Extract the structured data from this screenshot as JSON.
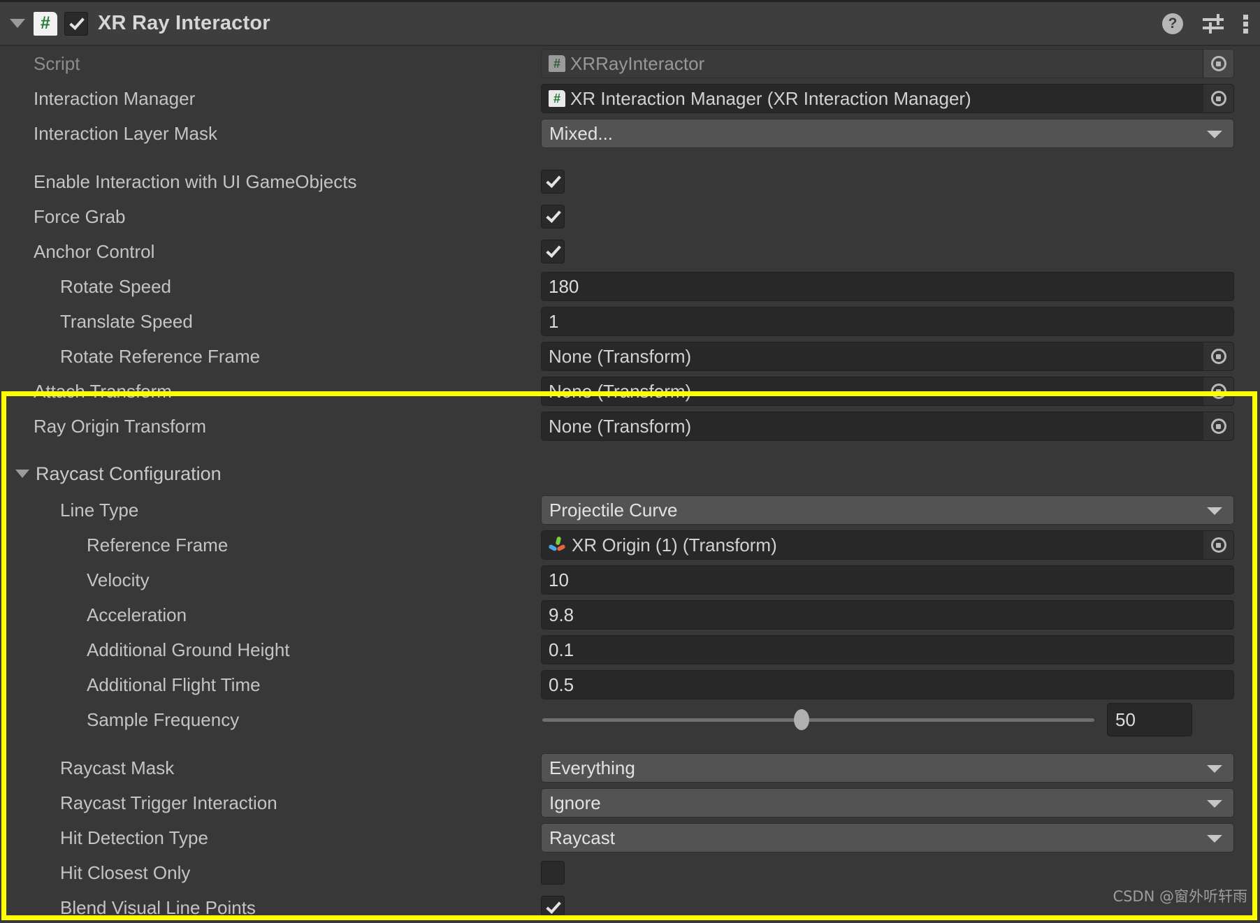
{
  "header": {
    "title": "XR Ray Interactor",
    "foldout_icon": "triangle-down-icon",
    "script_icon": "script-hash-icon",
    "enabled": true,
    "icons": {
      "help": "help-icon",
      "help_glyph": "?",
      "preset": "preset-sliders-icon",
      "menu": "kebab-menu-icon"
    }
  },
  "rows": [
    {
      "label": "Script",
      "indent": 0,
      "control": "object",
      "value": "XRRayInteractor",
      "icon": "script-hash-icon",
      "disabled": true
    },
    {
      "label": "Interaction Manager",
      "indent": 0,
      "control": "object",
      "value": "XR Interaction Manager (XR Interaction Manager)",
      "icon": "script-hash-icon"
    },
    {
      "label": "Interaction Layer Mask",
      "indent": 0,
      "control": "dropdown",
      "value": "Mixed..."
    },
    {
      "label": "Enable Interaction with UI GameObjects",
      "indent": 0,
      "control": "checkbox",
      "value": true,
      "gap": true
    },
    {
      "label": "Force Grab",
      "indent": 0,
      "control": "checkbox",
      "value": true
    },
    {
      "label": "Anchor Control",
      "indent": 0,
      "control": "checkbox",
      "value": true
    },
    {
      "label": "Rotate Speed",
      "indent": 1,
      "control": "text",
      "value": "180"
    },
    {
      "label": "Translate Speed",
      "indent": 1,
      "control": "text",
      "value": "1"
    },
    {
      "label": "Rotate Reference Frame",
      "indent": 1,
      "control": "object",
      "value": "None (Transform)"
    },
    {
      "label": "Attach Transform",
      "indent": 0,
      "control": "object",
      "value": "None (Transform)"
    },
    {
      "label": "Ray Origin Transform",
      "indent": 0,
      "control": "object",
      "value": "None (Transform)"
    }
  ],
  "section": {
    "title": "Raycast Configuration",
    "foldout_icon": "triangle-down-icon",
    "rows": [
      {
        "label": "Line Type",
        "indent": 1,
        "control": "dropdown",
        "value": "Projectile Curve"
      },
      {
        "label": "Reference Frame",
        "indent": 2,
        "control": "object",
        "value": "XR Origin (1) (Transform)",
        "icon": "transform-gizmo-icon"
      },
      {
        "label": "Velocity",
        "indent": 2,
        "control": "text",
        "value": "10"
      },
      {
        "label": "Acceleration",
        "indent": 2,
        "control": "text",
        "value": "9.8"
      },
      {
        "label": "Additional Ground Height",
        "indent": 2,
        "control": "text",
        "value": "0.1"
      },
      {
        "label": "Additional Flight Time",
        "indent": 2,
        "control": "text",
        "value": "0.5"
      },
      {
        "label": "Sample Frequency",
        "indent": 2,
        "control": "slider",
        "value": "50",
        "slider_pct": 47
      },
      {
        "label": "Raycast Mask",
        "indent": 1,
        "control": "dropdown",
        "value": "Everything",
        "gap": true
      },
      {
        "label": "Raycast Trigger Interaction",
        "indent": 1,
        "control": "dropdown",
        "value": "Ignore"
      },
      {
        "label": "Hit Detection Type",
        "indent": 1,
        "control": "dropdown",
        "value": "Raycast"
      },
      {
        "label": "Hit Closest Only",
        "indent": 1,
        "control": "checkbox",
        "value": false
      },
      {
        "label": "Blend Visual Line Points",
        "indent": 1,
        "control": "checkbox",
        "value": true
      }
    ]
  },
  "highlight": {
    "color": "#ffff00"
  },
  "watermark": "CSDN @窗外听轩雨"
}
